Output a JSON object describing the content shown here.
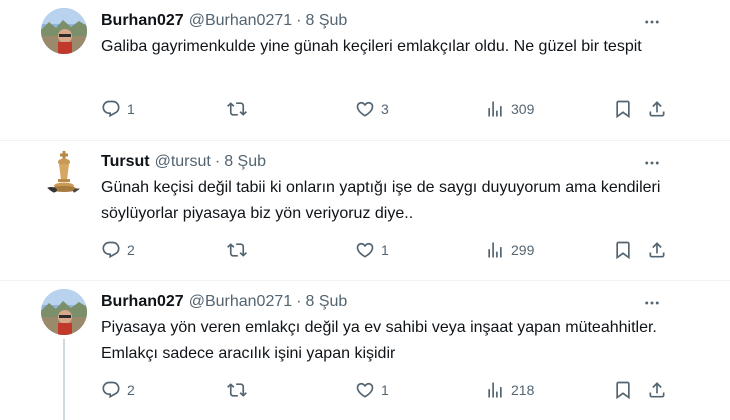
{
  "tweets": [
    {
      "name": "Burhan027",
      "handle": "@Burhan0271",
      "separator": "·",
      "date": "8 Şub",
      "text": "Galiba gayrimenkulde yine günah keçileri emlakçılar oldu. Ne güzel bir tespit",
      "replies": "1",
      "retweets": "",
      "likes": "3",
      "views": "309",
      "avatar": "landscape-avatar"
    },
    {
      "name": "Tursut",
      "handle": "@tursut",
      "separator": "·",
      "date": "8 Şub",
      "text": "Günah keçisi değil tabii ki onların yaptığı işe de saygı duyuyorum ama kendileri söylüyorlar piyasaya biz yön veriyoruz diye..",
      "replies": "2",
      "retweets": "",
      "likes": "1",
      "views": "299",
      "avatar": "chess-king-avatar"
    },
    {
      "name": "Burhan027",
      "handle": "@Burhan0271",
      "separator": "·",
      "date": "8 Şub",
      "text": "Piyasaya yön veren emlakçı değil ya ev sahibi veya inşaat yapan müteahhitler. Emlakçı sadece aracılık işini yapan kişidir",
      "replies": "2",
      "retweets": "",
      "likes": "1",
      "views": "218",
      "avatar": "landscape-avatar"
    }
  ],
  "colors": {
    "text": "#0f1419",
    "muted": "#536471",
    "thread_line": "#cfd9de",
    "divider": "#eff3f4"
  }
}
